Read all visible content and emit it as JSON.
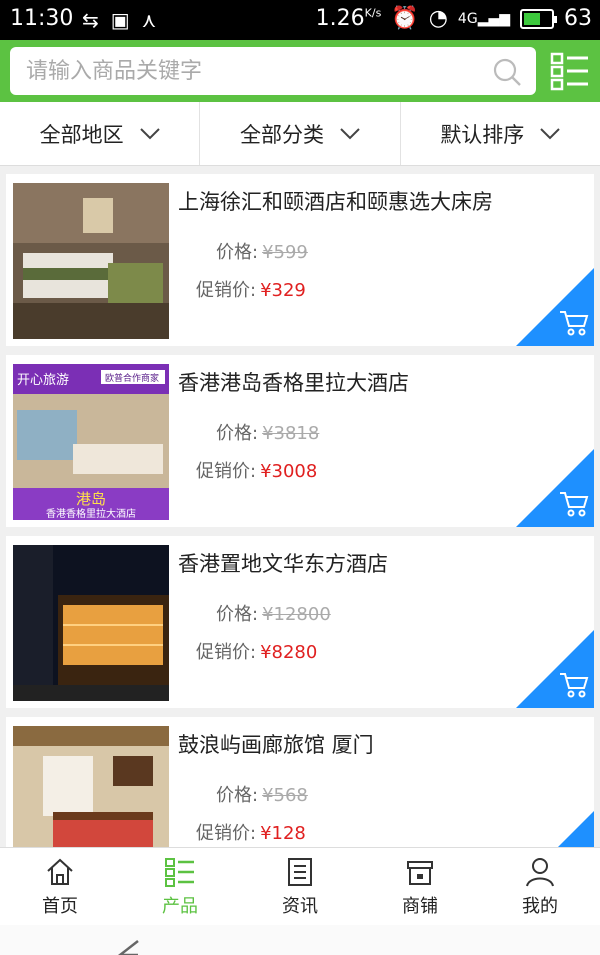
{
  "status": {
    "time": "11:30",
    "speed": "1.26",
    "speed_unit": "K/s",
    "network": "4G",
    "battery": "63",
    "battery_level": 0.63
  },
  "search": {
    "placeholder": "请输入商品关键字"
  },
  "filters": [
    {
      "label": "全部地区"
    },
    {
      "label": "全部分类"
    },
    {
      "label": "默认排序"
    }
  ],
  "products": [
    {
      "name": "上海徐汇和颐酒店和颐惠选大床房",
      "price_label": "价格:",
      "price": "¥599",
      "sale_label": "促销价:",
      "sale_price": "¥329"
    },
    {
      "name": "香港港岛香格里拉大酒店",
      "price_label": "价格:",
      "price": "¥3818",
      "sale_label": "促销价:",
      "sale_price": "¥3008",
      "badge_left": "开心旅游",
      "badge_right": "欧普合作商家",
      "caption_title": "港岛",
      "caption_sub": "香港香格里拉大酒店"
    },
    {
      "name": "香港置地文华东方酒店",
      "price_label": "价格:",
      "price": "¥12800",
      "sale_label": "促销价:",
      "sale_price": "¥8280"
    },
    {
      "name": "鼓浪屿画廊旅馆 厦门",
      "price_label": "价格:",
      "price": "¥568",
      "sale_label": "促销价:",
      "sale_price": "¥128"
    }
  ],
  "tabs": [
    {
      "label": "首页",
      "icon": "home-icon"
    },
    {
      "label": "产品",
      "icon": "list-icon"
    },
    {
      "label": "资讯",
      "icon": "news-icon"
    },
    {
      "label": "商铺",
      "icon": "shop-icon"
    },
    {
      "label": "我的",
      "icon": "user-icon"
    }
  ],
  "colors": {
    "accent": "#5cc242",
    "sale": "#e02020",
    "cart_badge": "#1e90ff"
  }
}
